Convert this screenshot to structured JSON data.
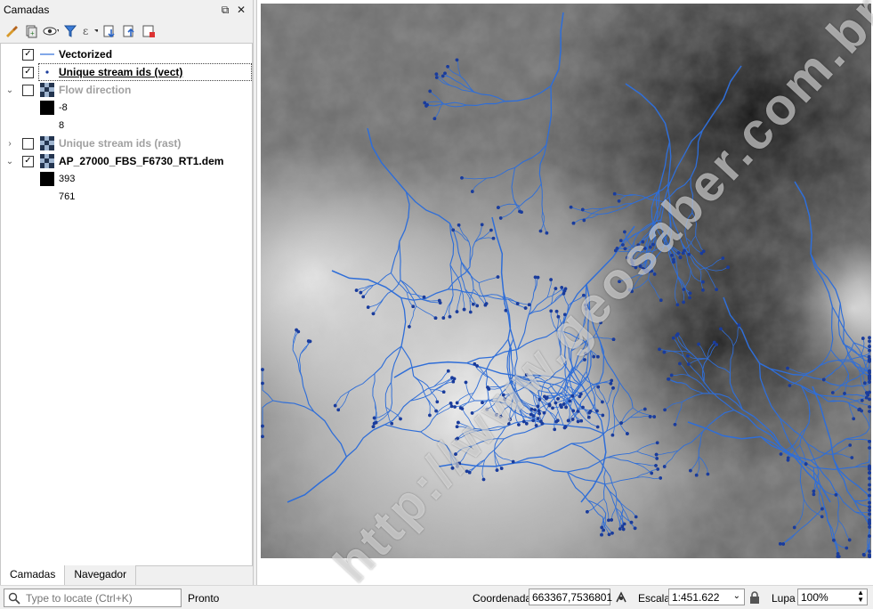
{
  "panel": {
    "title": "Camadas",
    "tabs": [
      "Camadas",
      "Navegador"
    ]
  },
  "layers": [
    {
      "name": "Vectorized",
      "checked": true,
      "icon": "line-symbol-icon"
    },
    {
      "name": "Unique stream ids (vect)",
      "checked": true,
      "icon": "point-symbol-icon"
    },
    {
      "name": "Flow direction",
      "checked": false,
      "icon": "raster-icon",
      "legend": [
        "-8",
        "8"
      ]
    },
    {
      "name": "Unique stream ids (rast)",
      "checked": false,
      "icon": "raster-icon"
    },
    {
      "name": "AP_27000_FBS_F6730_RT1.dem",
      "checked": true,
      "icon": "raster-icon",
      "legend": [
        "393",
        "761"
      ]
    }
  ],
  "status": {
    "locate_placeholder": "Type to locate (Ctrl+K)",
    "message": "Pronto",
    "coord_label": "Coordenada",
    "coord_value": "663367,7536801",
    "scale_label": "Escala",
    "scale_value": "1:451.622",
    "magnifier_label": "Lupa",
    "magnifier_value": "100%"
  },
  "map": {
    "watermark": "http://www.geosaber.com.br",
    "stream_color": "#2f6ed8",
    "point_color": "#1a3c9c"
  }
}
